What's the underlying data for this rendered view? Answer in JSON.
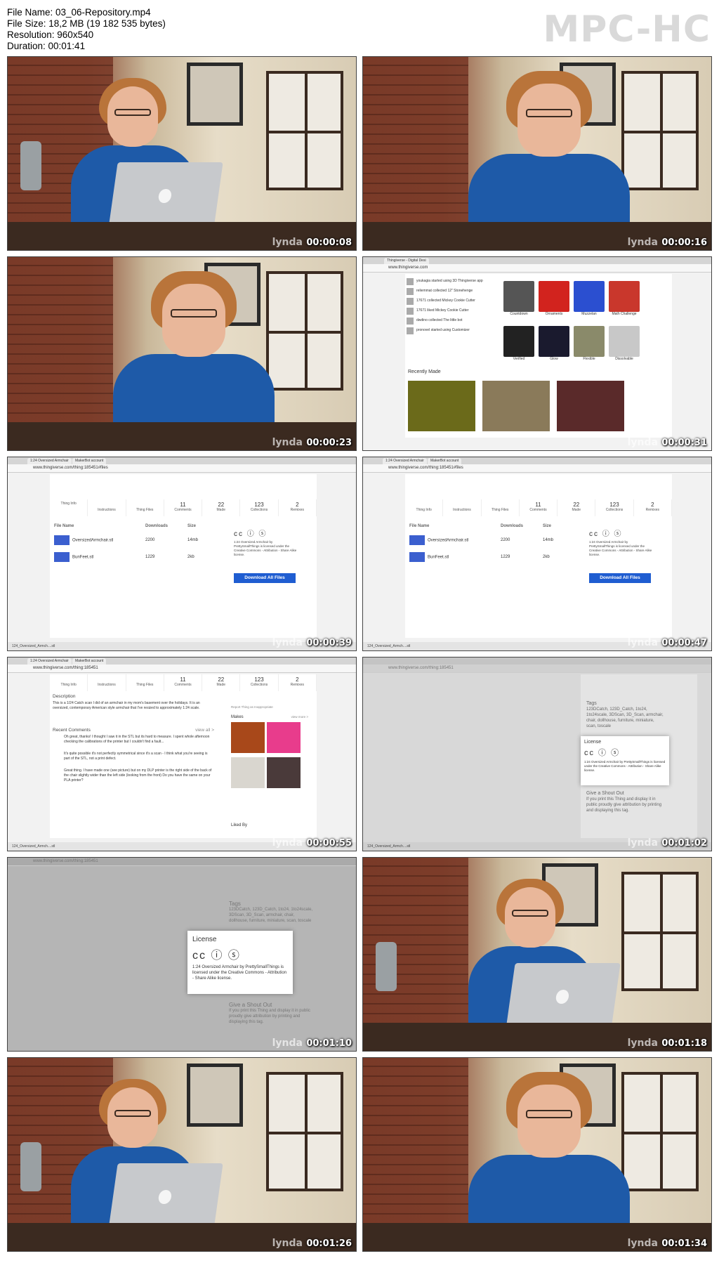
{
  "info": {
    "file_name": "File Name: 03_06-Repository.mp4",
    "file_size": "File Size: 18,2 MB (19 182 535 bytes)",
    "resolution": "Resolution: 960x540",
    "duration": "Duration: 00:01:41"
  },
  "brand": "MPC-HC",
  "watermark": "lynda",
  "thumbnails": [
    {
      "time": "00:00:08"
    },
    {
      "time": "00:00:16"
    },
    {
      "time": "00:00:23"
    },
    {
      "time": "00:00:31"
    },
    {
      "time": "00:00:39"
    },
    {
      "time": "00:00:47"
    },
    {
      "time": "00:00:55"
    },
    {
      "time": "00:01:02"
    },
    {
      "time": "00:01:10"
    },
    {
      "time": "00:01:18"
    },
    {
      "time": "00:01:26"
    },
    {
      "time": "00:01:34"
    }
  ],
  "browser": {
    "tab_thingiverse": "Thingiverse - Digital Desi",
    "tab_thing": "1:24 Oversized Armchair",
    "tab_makerbot": "MakerBot account",
    "url_home": "www.thingiverse.com",
    "url_files": "www.thingiverse.com/thing:185451#files",
    "url_thing": "www.thingiverse.com/thing:185451",
    "status_url": "www.thingiverse.com/thing:185451#files",
    "status_download": "124_Oversized_Armch....stl"
  },
  "thing_tabs": [
    {
      "count": "",
      "label": "Thing Info"
    },
    {
      "count": "",
      "label": "Instructions"
    },
    {
      "count": "",
      "label": "Thing Files"
    },
    {
      "count": "11",
      "label": "Comments"
    },
    {
      "count": "22",
      "label": "Made"
    },
    {
      "count": "123",
      "label": "Collections"
    },
    {
      "count": "2",
      "label": "Remixes"
    }
  ],
  "files": {
    "col_name": "File Name",
    "col_downloads": "Downloads",
    "col_size": "Size",
    "rows": [
      {
        "name": "OversizedArmchair.stl",
        "downloads": "2200",
        "size": "14mb"
      },
      {
        "name": "BunFeet.stl",
        "downloads": "1229",
        "size": "2kb"
      }
    ],
    "download_all": "Download All Files",
    "license_short": "1:24 Oversized Armchair by PrettySmallThings is licensed under the Creative Commons - Attribution - Share Alike license."
  },
  "dashboard": {
    "feed": [
      "youkagia started using 3D Thingiverse app",
      "reliemmat collected 12\" Stonehenge",
      "17671 collected Mickey Cookie Cutter",
      "17671 liked Mickey Cookie Cutter",
      "dwdino collected The little bot",
      "pronovel started using Customizer"
    ],
    "gallery": [
      {
        "label": "Countdown",
        "color": "#555"
      },
      {
        "label": "Ornaments",
        "color": "#d2231e"
      },
      {
        "label": "Muzzelan",
        "color": "#2b4fd0"
      },
      {
        "label": "Math Challenge",
        "color": "#c9372c"
      },
      {
        "label": "Verified",
        "color": "#222"
      },
      {
        "label": "Glow",
        "color": "#1a1a2e"
      },
      {
        "label": "Flexible",
        "color": "#8a8a6a"
      },
      {
        "label": "Dissolvable",
        "color": "#c8c8c8"
      }
    ],
    "recently_made": "Recently Made"
  },
  "thing_info": {
    "desc_title": "Description",
    "desc_text": "This is a 1/24 Catch scan I did of an armchair in my mom's basement over the holidays. It is an oversized, contemporary American style armchair that I've resized to approximately 1:24 scale.",
    "comments_title": "Recent Comments",
    "view_all": "view all >",
    "comments": [
      "Oh great, thanks! I thought I saw it in the STL but its hard to measure. I spent whole afternoon checking the calibrations of the printer but I couldn't find a fault...",
      "It's quite possible it's not perfectly symmetrical since it's a scan - I think what you're seeing is part of the STL, not a print defect.",
      "Great thing. I have made one (see picture) but on my DLP printer is the right side of the back of the chair slightly wider than the left side (looking from the front) Do you have the same on your PLA printer?"
    ],
    "makes_title": "Makes",
    "view_more": "view more >",
    "liked_by": "Liked By",
    "report": "Report Thing as Inappropriate"
  },
  "license": {
    "title": "License",
    "icons": "cc ⓘ ⓢ",
    "text": "1:24 Oversized Armchair by PrettySmallThings is licensed under the Creative Commons - Attribution - Share Alike license.",
    "tags_title": "Tags",
    "tags_text": "123DCatch, 123D_Catch, 1to24, 1to24scale, 3DScan, 3D_Scan, armchair, chair, dollhouse, furniture, miniature, scan, toscale",
    "shout_title": "Give a Shout Out",
    "shout_text": "If you print this Thing and display it in public proudly give attribution by printing and displaying this tag."
  }
}
